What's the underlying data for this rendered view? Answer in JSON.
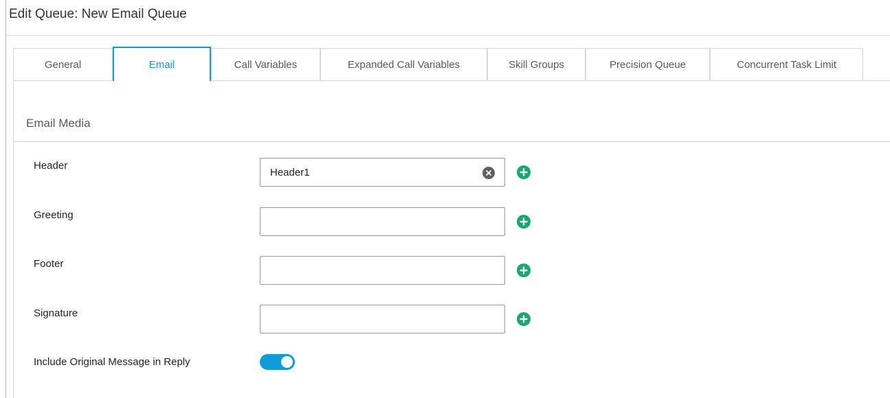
{
  "page": {
    "title": "Edit Queue: New Email Queue"
  },
  "tabs": [
    {
      "label": "General",
      "active": false
    },
    {
      "label": "Email",
      "active": true
    },
    {
      "label": "Call Variables",
      "active": false
    },
    {
      "label": "Expanded Call Variables",
      "active": false
    },
    {
      "label": "Skill Groups",
      "active": false
    },
    {
      "label": "Precision Queue",
      "active": false
    },
    {
      "label": "Concurrent Task Limit",
      "active": false
    }
  ],
  "section": {
    "title": "Email Media"
  },
  "fields": {
    "header": {
      "label": "Header",
      "value": "Header1"
    },
    "greeting": {
      "label": "Greeting",
      "value": ""
    },
    "footer": {
      "label": "Footer",
      "value": ""
    },
    "signature": {
      "label": "Signature",
      "value": ""
    }
  },
  "include_original": {
    "label": "Include Original Message in Reply",
    "enabled": true
  },
  "icons": {
    "clear": "close-circle-icon",
    "add": "plus-circle-icon"
  },
  "colors": {
    "accent": "#0d9ddb",
    "add_green": "#13a874",
    "clear_gray": "#5f5f62"
  }
}
